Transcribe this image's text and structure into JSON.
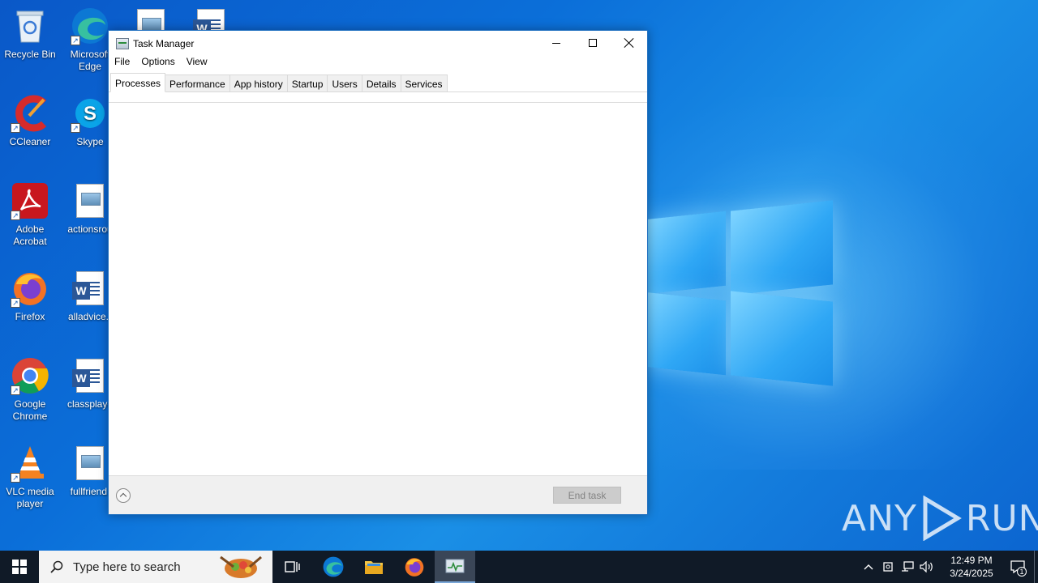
{
  "desktop": {
    "icons": [
      {
        "label": "Recycle Bin"
      },
      {
        "label": "Microsoft Edge"
      },
      {
        "label": "CCleaner"
      },
      {
        "label": "Skype"
      },
      {
        "label": "Adobe Acrobat"
      },
      {
        "label": "actionsrou"
      },
      {
        "label": "Firefox"
      },
      {
        "label": "alladvice.r"
      },
      {
        "label": "Google Chrome"
      },
      {
        "label": "classplaye"
      },
      {
        "label": "VLC media player"
      },
      {
        "label": "fullfriend."
      }
    ]
  },
  "task_manager": {
    "title": "Task Manager",
    "menu": [
      "File",
      "Options",
      "View"
    ],
    "tabs": [
      "Processes",
      "Performance",
      "App history",
      "Startup",
      "Users",
      "Details",
      "Services"
    ],
    "active_tab": "Processes",
    "end_task_label": "End task"
  },
  "watermark": {
    "left": "ANY",
    "right": "RUN"
  },
  "taskbar": {
    "search_placeholder": "Type here to search",
    "pinned": [
      "task-view-icon",
      "edge-icon",
      "file-explorer-icon",
      "firefox-icon",
      "task-manager-icon"
    ],
    "clock_time": "12:49 PM",
    "clock_date": "3/24/2025",
    "notification_count": "1"
  }
}
